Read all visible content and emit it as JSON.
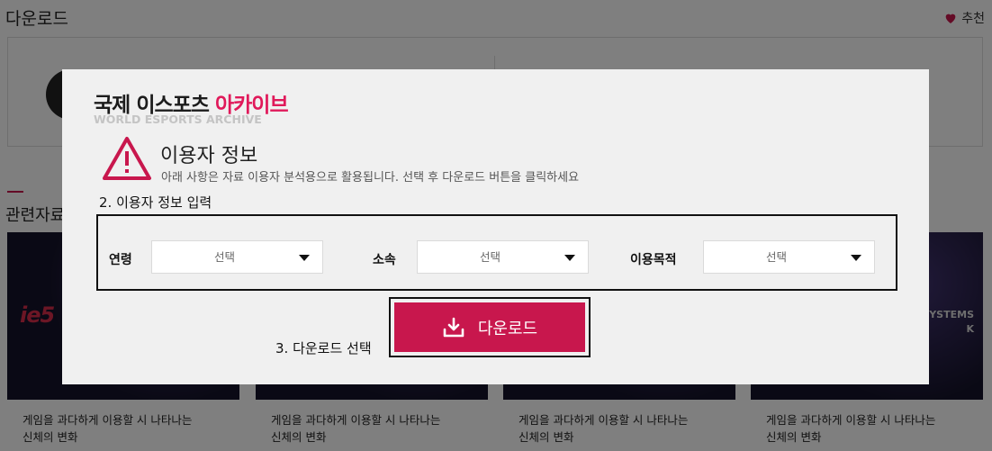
{
  "background": {
    "page_title": "다운로드",
    "recommend_label": "추천",
    "related_title": "관련자료",
    "cards": [
      {
        "logo": "ie5",
        "side": "",
        "caption_line1": "게임을 과다하게 이용할 시 나타나는",
        "caption_line2": "신체의 변화"
      },
      {
        "logo": "",
        "side": "",
        "caption_line1": "게임을 과다하게 이용할 시 나타나는",
        "caption_line2": "신체의 변화"
      },
      {
        "logo": "",
        "side": "",
        "caption_line1": "게임을 과다하게 이용할 시 나타나는",
        "caption_line2": "신체의 변화"
      },
      {
        "logo": "",
        "side": "YSTEMS\nK",
        "caption_line1": "게임을 과다하게 이용할 시 나타나는",
        "caption_line2": "신체의 변화"
      }
    ]
  },
  "modal": {
    "brand": {
      "dark": "국제 이스포츠",
      "pink": "아카이브",
      "sub": "WORLD ESPORTS ARCHIVE"
    },
    "notice_title": "이용자 정보",
    "notice_desc": "아래 사항은 자료 이용자 분석용으로 활용됩니다. 선택 후 다운로드 버튼을 클릭하세요",
    "step2_label": "2. 이용자 정보 입력",
    "fields": [
      {
        "label": "연령",
        "value": "선택"
      },
      {
        "label": "소속",
        "value": "선택"
      },
      {
        "label": "이용목적",
        "value": "선택"
      }
    ],
    "step3_label": "3. 다운로드 선택",
    "download_label": "다운로드"
  },
  "colors": {
    "accent": "#c8174d",
    "brand_pink": "#e0195a"
  },
  "icons": {
    "recommend": "heart-icon",
    "warning": "warning-triangle-icon",
    "download": "download-icon",
    "select": "caret-down-icon"
  }
}
